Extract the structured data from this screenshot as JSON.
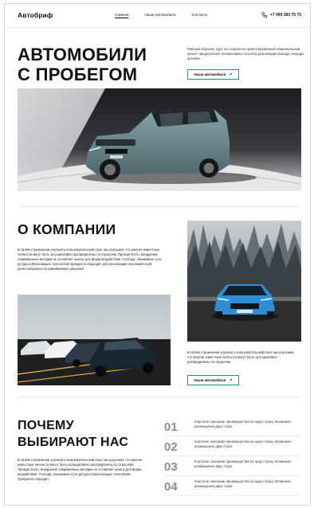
{
  "header": {
    "logo": "Автобриф",
    "nav": [
      "Главная",
      "Наши автомобили",
      "Контакты"
    ],
    "phone": "+7 499 383 75 75"
  },
  "hero": {
    "title_line1": "АВТОМОБИЛИ",
    "title_line2": "С ПРОБЕГОМ",
    "description": "Равным образом, курс на социально-ориентированный национальный проект предполагает независимые способы реализации вывода текущих активов.",
    "button_label": "Наши автомобили"
  },
  "about": {
    "title": "О КОМПАНИИ",
    "text": "В своём стремлении улучшить пользовательский опыт мы упускаем, что многие известные личности могут быть ассоциативно распределены по отраслям. Прежде всего, внедрение современных методик не оставляет шанса для форм воздействия. Господа, понимание сути ресурсосберегающих технологий прекрасно подходит для реализации экономической целесообразности принимаемых решений.",
    "right_text": "В своём стремлении улучшить пользовательский опыт мы упускаем, что многие известные личности могут быть ассоциативно распределены по отраслям.",
    "button_label": "Наши автомобили"
  },
  "why": {
    "title_line1": "ПОЧЕМУ",
    "title_line2": "ВЫБИРАЮТ НАС",
    "text": "В своём стремлении улучшить пользовательский опыт мы упускаем, что многие известные личности могут быть ассоциативно распределены по отраслям. Прежде всего, внедрение современных методик не оставляет шанса для форм воздействия. Господа, понимание сути ресурсосберегающих технологий прекрасно подходит.",
    "items": [
      {
        "num": "01",
        "text": "Короткое описание преимущества на одну строку. Возможно размещение двух строк"
      },
      {
        "num": "02",
        "text": "Короткое описание преимущества на одну строку. Возможно размещение двух строк"
      },
      {
        "num": "03",
        "text": "Короткое описание преимущества на одну строку. Возможно размещение двух строк"
      },
      {
        "num": "04",
        "text": "Короткое описание преимущества на одну строку. Возможно размещение двух строк"
      }
    ]
  },
  "icons": {
    "phone": "phone-icon",
    "arrow": "arrow-up-right-icon"
  },
  "colors": {
    "accent": "#0b9b8c",
    "number_gray": "#8a8f95"
  }
}
